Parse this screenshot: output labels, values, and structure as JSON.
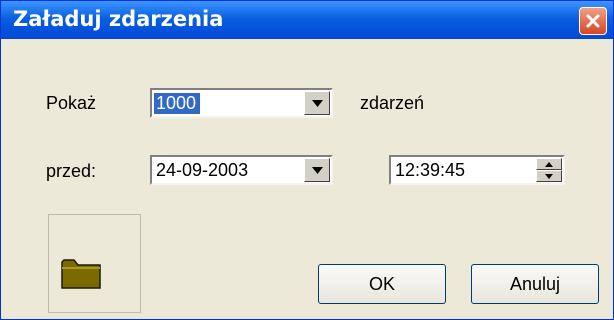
{
  "window": {
    "title": "Załaduj zdarzenia"
  },
  "form": {
    "show_label": "Pokaż",
    "count_value": "1000",
    "events_label": "zdarzeń",
    "before_label": "przed:",
    "date_value": "24-09-2003",
    "time_value": "12:39:45"
  },
  "buttons": {
    "ok_label": "OK",
    "cancel_label": "Anuluj"
  },
  "icons": {
    "close": "close-icon",
    "dropdown": "chevron-down-icon",
    "spin": "spinner-icon",
    "folder": "folder-icon"
  },
  "colors": {
    "titlebar": "#0a5fe0",
    "selection": "#316ac5",
    "close_button": "#d6451f",
    "dialog_background": "#ece9d8",
    "folder": "#7a6a00"
  }
}
